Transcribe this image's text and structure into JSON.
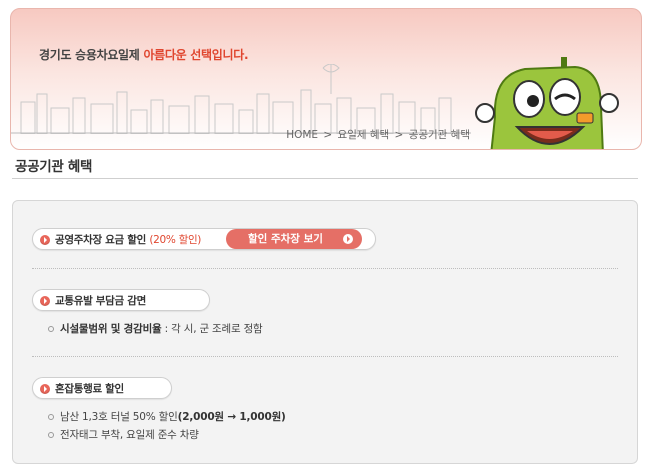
{
  "header": {
    "tagline_prefix": "경기도 승용차요일제",
    "tagline_accent": "아름다운 선택입니다."
  },
  "breadcrumb": [
    "HOME",
    ">",
    "요일제 혜택",
    ">",
    "공공기관 혜택"
  ],
  "page_title": "공공기관 혜택",
  "sections": {
    "parking": {
      "label": "공영주차장 요금 할인",
      "highlight": "(20% 할인)",
      "button_label": "할인 주차장 보기"
    },
    "traffic_fee": {
      "label": "교통유발 부담금 감면",
      "bullet_bold": "시설물범위 및 경감비율",
      "bullet_text": ": 각 시, 군 조례로 정함"
    },
    "congestion": {
      "label": "혼잡통행료 할인",
      "bullet1_text": "남산 1,3호 터널 50% 할인",
      "bullet1_bold": "(2,000원 → 1,000원)",
      "bullet2_text": "전자태그 부착, 요일제 준수 차량"
    }
  },
  "colors": {
    "accent": "#e0462f",
    "button": "#e56f66",
    "banner": "#f7c9c1",
    "car": "#9bc53d"
  }
}
